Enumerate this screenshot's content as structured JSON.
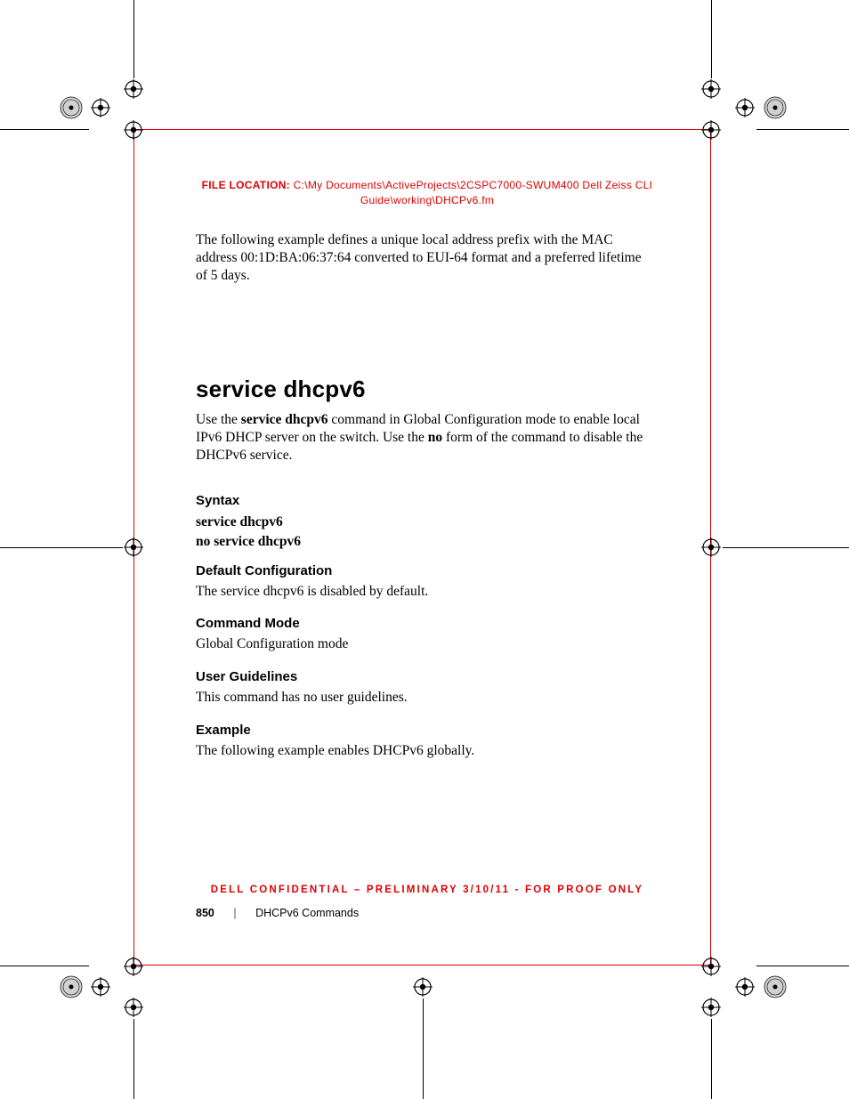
{
  "file_location": {
    "label": "FILE LOCATION:",
    "path_line1": "C:\\My Documents\\ActiveProjects\\2CSPC7000-SWUM400 Dell Zeiss CLI",
    "path_line2": "Guide\\working\\DHCPv6.fm"
  },
  "intro_para": "The following example defines a unique local address prefix with the MAC address 00:1D:BA:06:37:64 converted to EUI-64 format and a preferred lifetime of 5 days.",
  "heading": "service dhcpv6",
  "desc_parts": {
    "p1": "Use the ",
    "b1": "service dhcpv6",
    "p2": " command in Global Configuration mode to enable local IPv6 DHCP server on the switch. Use the ",
    "b2": "no",
    "p3": " form of the command to disable the DHCPv6 service."
  },
  "sections": {
    "syntax": {
      "title": "Syntax",
      "line1": "service dhcpv6",
      "line2": "no service dhcpv6"
    },
    "default_cfg": {
      "title": "Default Configuration",
      "text": "The service dhcpv6 is disabled by default."
    },
    "cmd_mode": {
      "title": "Command Mode",
      "text": "Global Configuration mode"
    },
    "user_guidelines": {
      "title": "User Guidelines",
      "text": "This command has no user guidelines."
    },
    "example": {
      "title": "Example",
      "text": "The following example enables DHCPv6 globally."
    }
  },
  "confidential": "DELL CONFIDENTIAL – PRELIMINARY 3/10/11 - FOR PROOF ONLY",
  "footer": {
    "page": "850",
    "chapter": "DHCPv6 Commands"
  }
}
